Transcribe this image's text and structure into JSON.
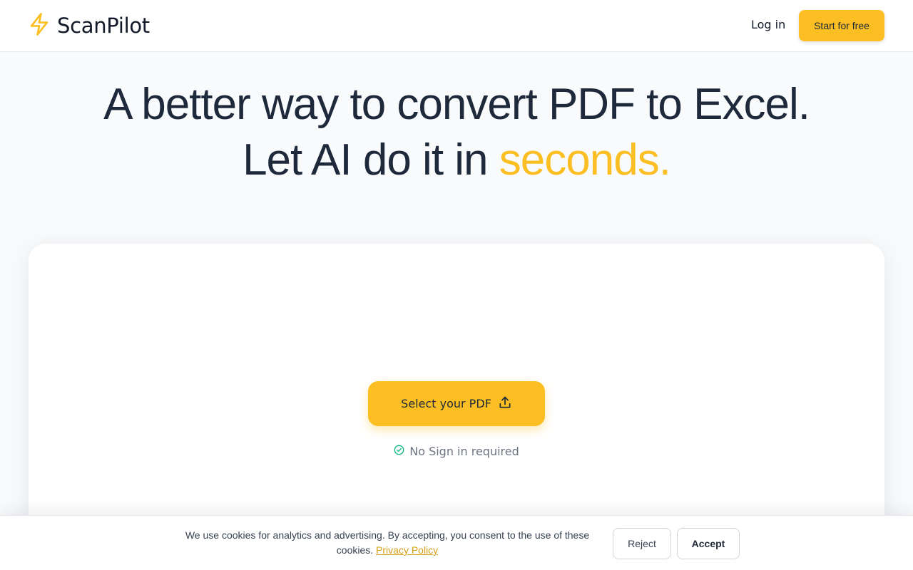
{
  "header": {
    "brand": "ScanPilot",
    "brand_icon": "lightning-bolt-icon",
    "login_label": "Log in",
    "start_label": "Start for free"
  },
  "hero": {
    "line1": "A better way to convert PDF to Excel.",
    "line2_prefix": "Let AI do it in ",
    "line2_accent": "seconds."
  },
  "upload": {
    "button_label": "Select your PDF",
    "button_icon": "upload-icon",
    "note": "No Sign in required",
    "note_icon": "check-circle-icon"
  },
  "cookie": {
    "text": "We use cookies for analytics and advertising. By accepting, you consent to the use of these cookies.",
    "link_label": "Privacy Policy",
    "reject_label": "Reject",
    "accept_label": "Accept"
  },
  "colors": {
    "accent": "#fbbf24",
    "text_dark": "#1e293b",
    "check_green": "#10b981",
    "background": "#f8fafc"
  }
}
